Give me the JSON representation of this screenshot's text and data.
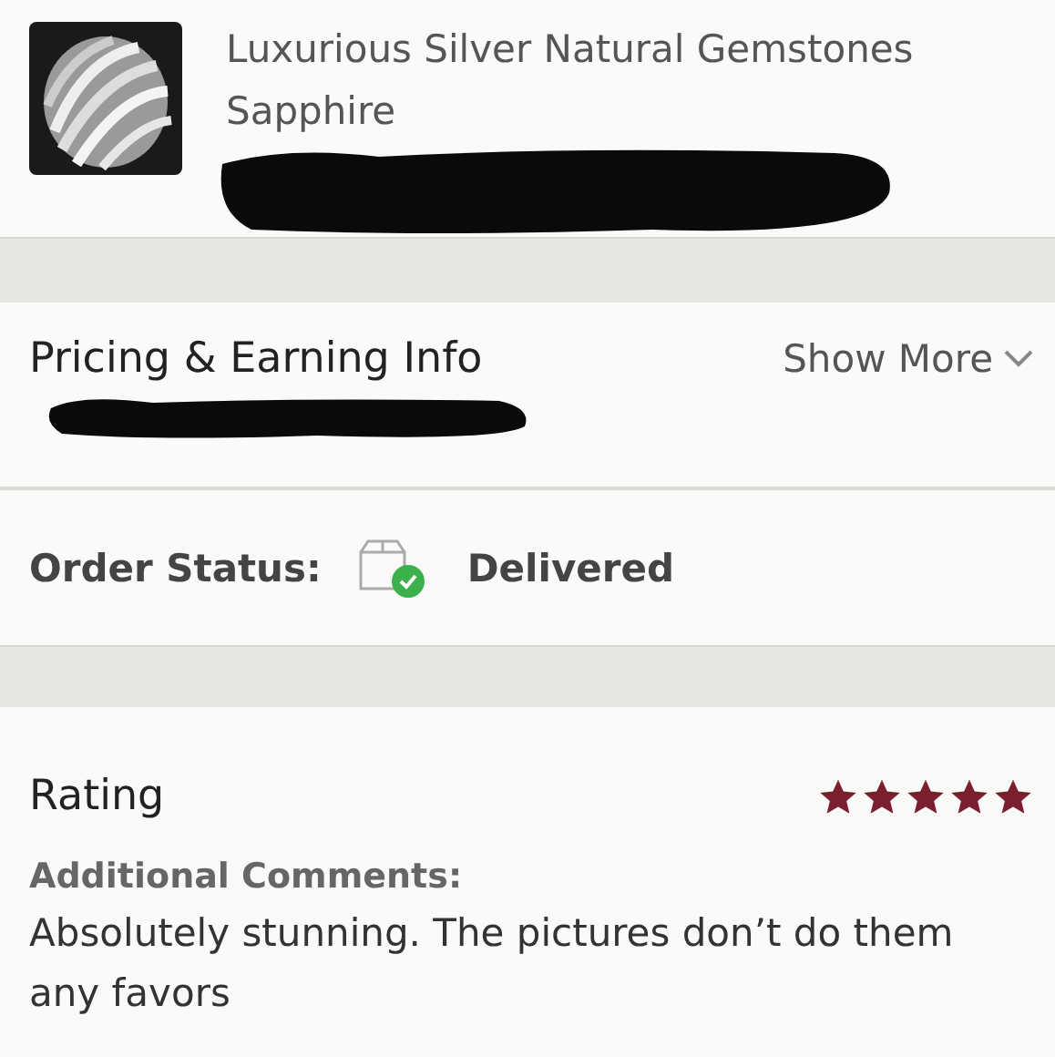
{
  "product": {
    "title": "Luxurious Silver Natural Gemstones Sapphire"
  },
  "pricing": {
    "title": "Pricing & Earning Info",
    "toggle": "Show More"
  },
  "order_status": {
    "label": "Order Status:",
    "value": "Delivered"
  },
  "rating": {
    "label": "Rating",
    "stars": 5,
    "comments_label": "Additional Comments:",
    "comments": "Absolutely stunning. The pictures don’t do them any favors"
  }
}
